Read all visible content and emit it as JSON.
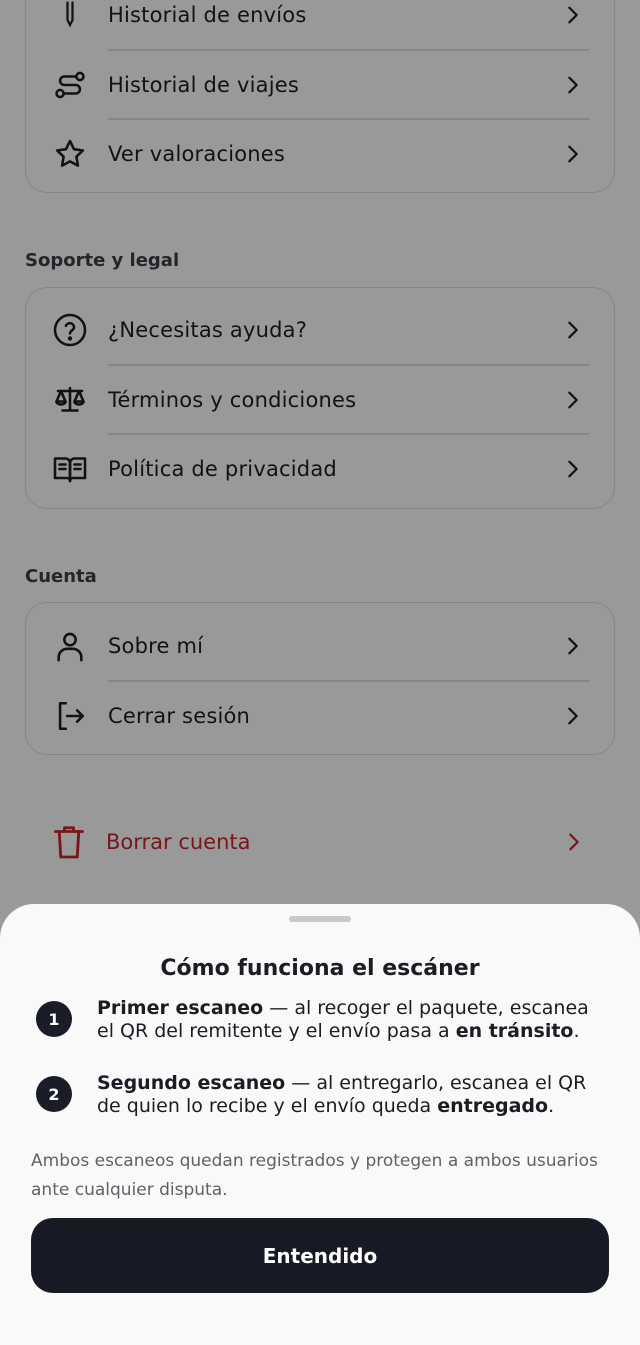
{
  "activity": {
    "items": [
      {
        "icon": "shipment-history-icon",
        "label": "Historial de envíos"
      },
      {
        "icon": "route-icon",
        "label": "Historial de viajes"
      },
      {
        "icon": "star-icon",
        "label": "Ver valoraciones"
      }
    ]
  },
  "support": {
    "title": "Soporte y legal",
    "items": [
      {
        "icon": "help-circle-icon",
        "label": "¿Necesitas ayuda?"
      },
      {
        "icon": "scale-icon",
        "label": "Términos y condiciones"
      },
      {
        "icon": "open-book-icon",
        "label": "Política de privacidad"
      }
    ]
  },
  "account": {
    "title": "Cuenta",
    "items": [
      {
        "icon": "user-icon",
        "label": "Sobre mí"
      },
      {
        "icon": "logout-icon",
        "label": "Cerrar sesión"
      }
    ],
    "delete_label": "Borrar cuenta"
  },
  "sheet": {
    "title": "Cómo funciona el escáner",
    "steps": [
      {
        "num": "1",
        "bold": "Primer escaneo",
        "text": " — al recoger el paquete, escanea el QR del remitente y el envío pasa a ",
        "bold2": "en tránsito",
        "end": "."
      },
      {
        "num": "2",
        "bold": "Segundo escaneo",
        "text": " — al entregarlo, escanea el QR de quien lo recibe y el envío queda ",
        "bold2": "entregado",
        "end": "."
      }
    ],
    "note": "Ambos escaneos quedan registrados y protegen a ambos usuarios ante cualquier disputa.",
    "button_label": "Entendido"
  },
  "colors": {
    "primary_dark": "#171a24",
    "danger": "#c0262d",
    "overlay": "rgba(0,0,0,0.38)"
  }
}
